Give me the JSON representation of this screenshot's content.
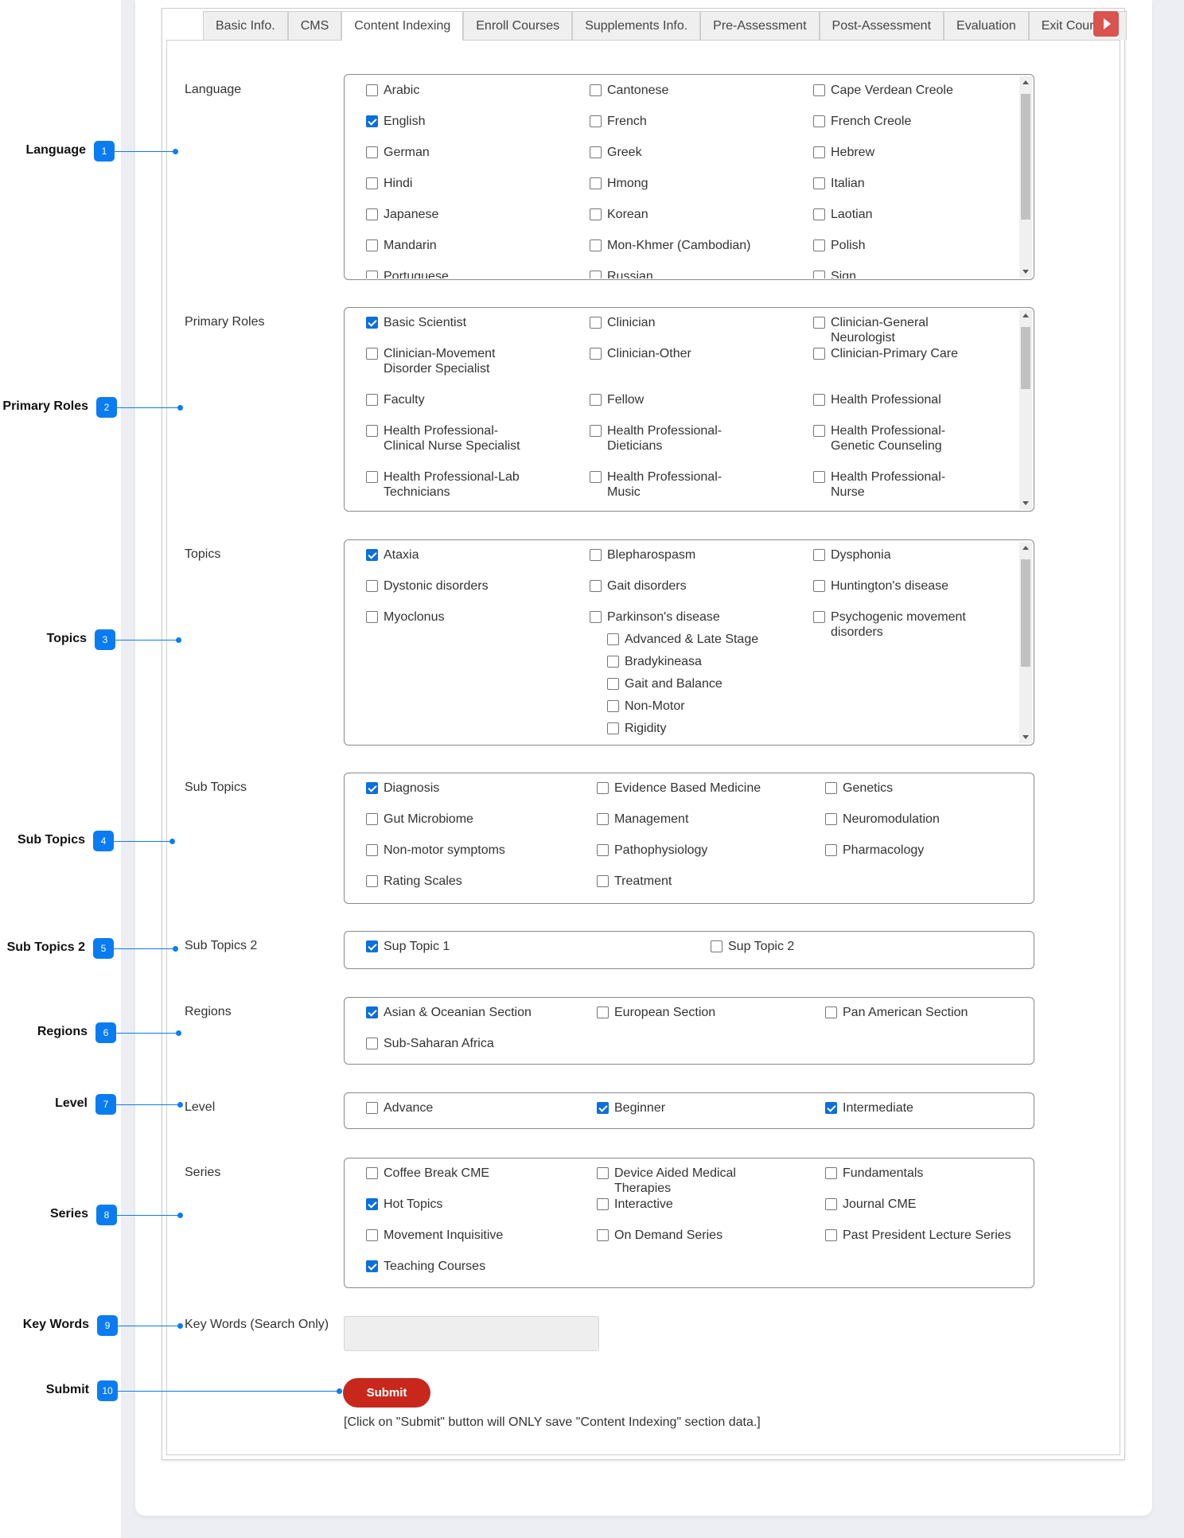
{
  "tabs": [
    "Basic Info.",
    "CMS",
    "Content Indexing",
    "Enroll Courses",
    "Supplements Info.",
    "Pre-Assessment",
    "Post-Assessment",
    "Evaluation",
    "Exit Course I"
  ],
  "active_tab": "Content Indexing",
  "accent_color": "#0a7cf2",
  "submit_color": "#c8281c",
  "annotations": [
    {
      "label": "Language",
      "num": "1"
    },
    {
      "label": "Primary Roles",
      "num": "2"
    },
    {
      "label": "Topics",
      "num": "3"
    },
    {
      "label": "Sub Topics",
      "num": "4"
    },
    {
      "label": "Sub Topics 2",
      "num": "5"
    },
    {
      "label": "Regions",
      "num": "6"
    },
    {
      "label": "Level",
      "num": "7"
    },
    {
      "label": "Series",
      "num": "8"
    },
    {
      "label": "Key Words",
      "num": "9"
    },
    {
      "label": "Submit",
      "num": "10"
    }
  ],
  "sections": {
    "language": {
      "label": "Language",
      "items": [
        {
          "text": "Arabic",
          "checked": false
        },
        {
          "text": "Cantonese",
          "checked": false
        },
        {
          "text": "Cape Verdean Creole",
          "checked": false
        },
        {
          "text": "English",
          "checked": true
        },
        {
          "text": "French",
          "checked": false
        },
        {
          "text": "French Creole",
          "checked": false
        },
        {
          "text": "German",
          "checked": false
        },
        {
          "text": "Greek",
          "checked": false
        },
        {
          "text": "Hebrew",
          "checked": false
        },
        {
          "text": "Hindi",
          "checked": false
        },
        {
          "text": "Hmong",
          "checked": false
        },
        {
          "text": "Italian",
          "checked": false
        },
        {
          "text": "Japanese",
          "checked": false
        },
        {
          "text": "Korean",
          "checked": false
        },
        {
          "text": "Laotian",
          "checked": false
        },
        {
          "text": "Mandarin",
          "checked": false
        },
        {
          "text": "Mon-Khmer (Cambodian)",
          "checked": false
        },
        {
          "text": "Polish",
          "checked": false
        },
        {
          "text": "Portuguese",
          "checked": false
        },
        {
          "text": "Russian",
          "checked": false
        },
        {
          "text": "Sign",
          "checked": false
        }
      ]
    },
    "roles": {
      "label": "Primary Roles",
      "items": [
        {
          "text": "Basic Scientist",
          "checked": true
        },
        {
          "text": "Clinician",
          "checked": false
        },
        {
          "text": "Clinician-General Neurologist",
          "checked": false
        },
        {
          "text": "Clinician-Movement Disorder Specialist",
          "checked": false
        },
        {
          "text": "Clinician-Other",
          "checked": false
        },
        {
          "text": "Clinician-Primary Care",
          "checked": false
        },
        {
          "text": "Faculty",
          "checked": false
        },
        {
          "text": "Fellow",
          "checked": false
        },
        {
          "text": "Health Professional",
          "checked": false
        },
        {
          "text": "Health Professional-Clinical Nurse Specialist",
          "checked": false
        },
        {
          "text": "Health Professional-Dieticians",
          "checked": false
        },
        {
          "text": "Health Professional-Genetic Counseling",
          "checked": false
        },
        {
          "text": "Health Professional-Lab Technicians",
          "checked": false
        },
        {
          "text": "Health Professional-Music",
          "checked": false
        },
        {
          "text": "Health Professional-Nurse",
          "checked": false
        }
      ]
    },
    "topics": {
      "label": "Topics",
      "items": [
        {
          "text": "Ataxia",
          "checked": true
        },
        {
          "text": "Blepharospasm",
          "checked": false
        },
        {
          "text": "Dysphonia",
          "checked": false
        },
        {
          "text": "Dystonic disorders",
          "checked": false
        },
        {
          "text": "Gait disorders",
          "checked": false
        },
        {
          "text": "Huntington's disease",
          "checked": false
        },
        {
          "text": "Myoclonus",
          "checked": false
        },
        {
          "text": "Parkinson's disease",
          "checked": false
        },
        {
          "text": "Psychogenic movement disorders",
          "checked": false
        }
      ],
      "subitems": [
        {
          "text": "Advanced & Late Stage",
          "checked": false
        },
        {
          "text": "Bradykineasa",
          "checked": false
        },
        {
          "text": "Gait and Balance",
          "checked": false
        },
        {
          "text": "Non-Motor",
          "checked": false
        },
        {
          "text": "Rigidity",
          "checked": false
        }
      ]
    },
    "subtopics": {
      "label": "Sub Topics",
      "items": [
        {
          "text": "Diagnosis",
          "checked": true
        },
        {
          "text": "Evidence Based Medicine",
          "checked": false
        },
        {
          "text": "Genetics",
          "checked": false
        },
        {
          "text": "Gut Microbiome",
          "checked": false
        },
        {
          "text": "Management",
          "checked": false
        },
        {
          "text": "Neuromodulation",
          "checked": false
        },
        {
          "text": "Non-motor symptoms",
          "checked": false
        },
        {
          "text": "Pathophysiology",
          "checked": false
        },
        {
          "text": "Pharmacology",
          "checked": false
        },
        {
          "text": "Rating Scales",
          "checked": false
        },
        {
          "text": "Treatment",
          "checked": false
        }
      ]
    },
    "subtopics2": {
      "label": "Sub Topics 2",
      "items": [
        {
          "text": "Sup Topic 1",
          "checked": true
        },
        {
          "text": "Sup Topic 2",
          "checked": false
        }
      ]
    },
    "regions": {
      "label": "Regions",
      "items": [
        {
          "text": "Asian & Oceanian Section",
          "checked": true
        },
        {
          "text": "European Section",
          "checked": false
        },
        {
          "text": "Pan American Section",
          "checked": false
        },
        {
          "text": "Sub-Saharan Africa",
          "checked": false
        }
      ]
    },
    "level": {
      "label": "Level",
      "items": [
        {
          "text": "Advance",
          "checked": false
        },
        {
          "text": "Beginner",
          "checked": true
        },
        {
          "text": "Intermediate",
          "checked": true
        }
      ]
    },
    "series": {
      "label": "Series",
      "items": [
        {
          "text": "Coffee Break CME",
          "checked": false
        },
        {
          "text": "Device Aided Medical Therapies",
          "checked": false
        },
        {
          "text": "Fundamentals",
          "checked": false
        },
        {
          "text": "Hot Topics",
          "checked": true
        },
        {
          "text": "Interactive",
          "checked": false
        },
        {
          "text": "Journal CME",
          "checked": false
        },
        {
          "text": "Movement Inquisitive",
          "checked": false
        },
        {
          "text": "On Demand Series",
          "checked": false
        },
        {
          "text": "Past President Lecture Series",
          "checked": false
        },
        {
          "text": "Teaching Courses",
          "checked": true
        }
      ]
    }
  },
  "keywords": {
    "label": "Key Words (Search Only)",
    "value": ""
  },
  "submit": {
    "label": "Submit",
    "note": "[Click on \"Submit\" button will ONLY save \"Content Indexing\" section data.]"
  }
}
